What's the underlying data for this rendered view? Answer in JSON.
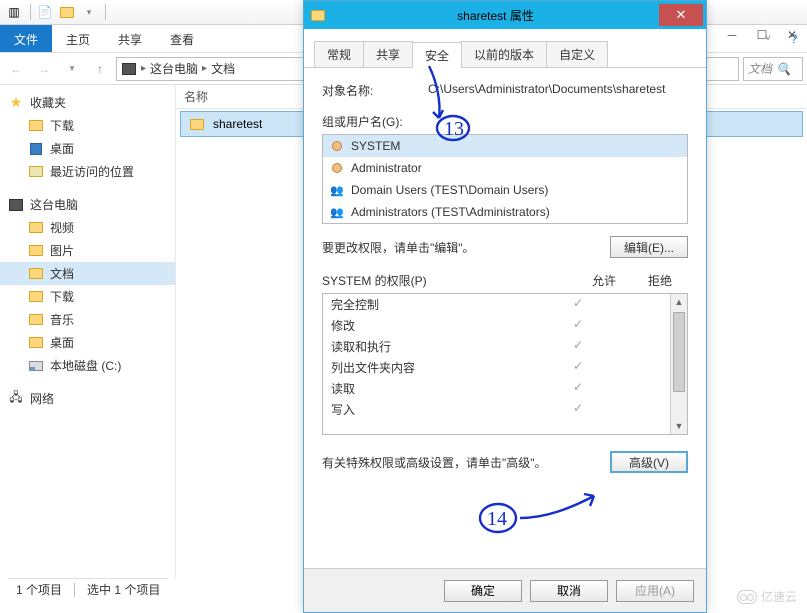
{
  "explorer": {
    "file_tab": "文件",
    "ribbon_tabs": [
      "主页",
      "共享",
      "查看"
    ],
    "breadcrumb": {
      "root_icon": "computer-icon",
      "root": "这台电脑",
      "current": "文档"
    },
    "search_placeholder": "文档",
    "nav": {
      "favorites": {
        "label": "收藏夹",
        "items": [
          "下载",
          "桌面",
          "最近访问的位置"
        ]
      },
      "this_pc": {
        "label": "这台电脑",
        "items": [
          "视频",
          "图片",
          "文档",
          "下载",
          "音乐",
          "桌面",
          "本地磁盘 (C:)"
        ],
        "selected_index": 2
      },
      "network": {
        "label": "网络"
      }
    },
    "list": {
      "header": "名称",
      "items": [
        "sharetest"
      ],
      "selected_index": 0
    },
    "status": {
      "count": "1 个项目",
      "selection": "选中 1 个项目"
    }
  },
  "dialog": {
    "title": "sharetest 属性",
    "tabs": [
      "常规",
      "共享",
      "安全",
      "以前的版本",
      "自定义"
    ],
    "active_tab_index": 2,
    "object_name_label": "对象名称:",
    "object_name_value": "C:\\Users\\Administrator\\Documents\\sharetest",
    "group_users_label": "组或用户名(G):",
    "groups": [
      {
        "name": "SYSTEM",
        "type": "user"
      },
      {
        "name": "Administrator",
        "type": "user"
      },
      {
        "name": "Domain Users (TEST\\Domain Users)",
        "type": "group"
      },
      {
        "name": "Administrators (TEST\\Administrators)",
        "type": "group"
      }
    ],
    "selected_group_index": 0,
    "edit_hint": "要更改权限，请单击\"编辑\"。",
    "edit_button": "编辑(E)...",
    "perm_header_name": "SYSTEM 的权限(P)",
    "perm_header_allow": "允许",
    "perm_header_deny": "拒绝",
    "permissions": [
      {
        "name": "完全控制",
        "allow": true,
        "deny": false
      },
      {
        "name": "修改",
        "allow": true,
        "deny": false
      },
      {
        "name": "读取和执行",
        "allow": true,
        "deny": false
      },
      {
        "name": "列出文件夹内容",
        "allow": true,
        "deny": false
      },
      {
        "name": "读取",
        "allow": true,
        "deny": false
      },
      {
        "name": "写入",
        "allow": true,
        "deny": false
      }
    ],
    "advanced_hint": "有关特殊权限或高级设置，请单击\"高级\"。",
    "advanced_button": "高级(V)",
    "footer": {
      "ok": "确定",
      "cancel": "取消",
      "apply": "应用(A)"
    }
  },
  "annotations": {
    "a13": "13",
    "a14": "14"
  },
  "watermark": "亿速云"
}
